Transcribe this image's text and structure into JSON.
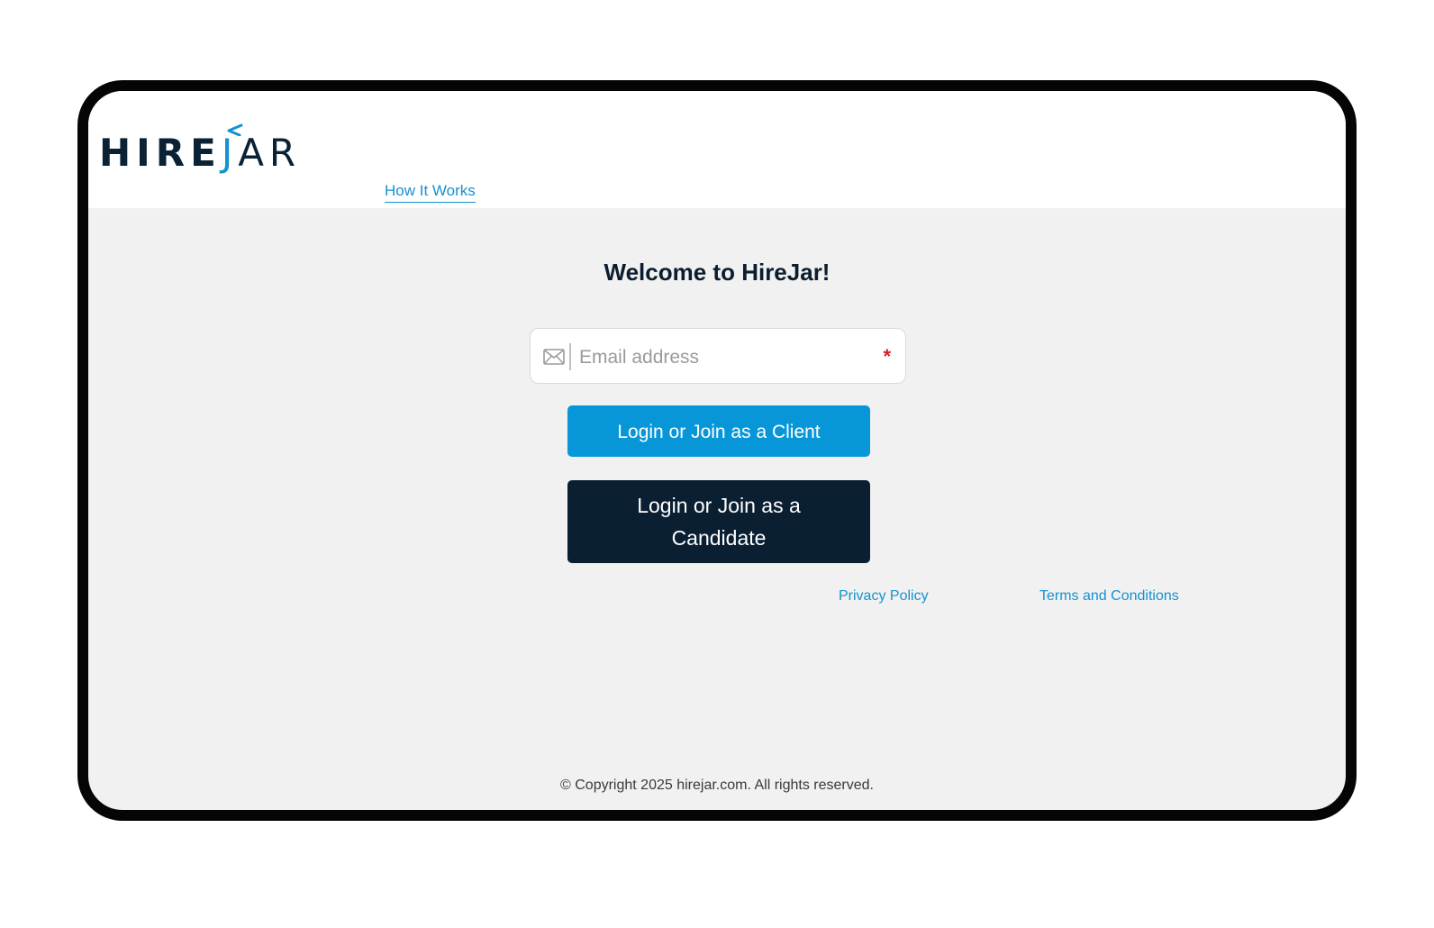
{
  "brand": {
    "logo_hire": "HIRE",
    "logo_j": "J",
    "logo_ar": "AR",
    "primary_color": "#1592d0",
    "dark_color": "#0b1f33"
  },
  "header": {
    "nav_link": "How It Works"
  },
  "main": {
    "title": "Welcome to HireJar!",
    "email": {
      "placeholder": "Email address",
      "value": "",
      "required_mark": "*",
      "icon": "envelope-icon"
    },
    "client_button": "Login or Join as a Client",
    "candidate_button": "Login or Join as a Candidate"
  },
  "footer": {
    "privacy": "Privacy Policy",
    "terms": "Terms and Conditions",
    "copyright": "© Copyright 2025 hirejar.com. All rights reserved."
  }
}
